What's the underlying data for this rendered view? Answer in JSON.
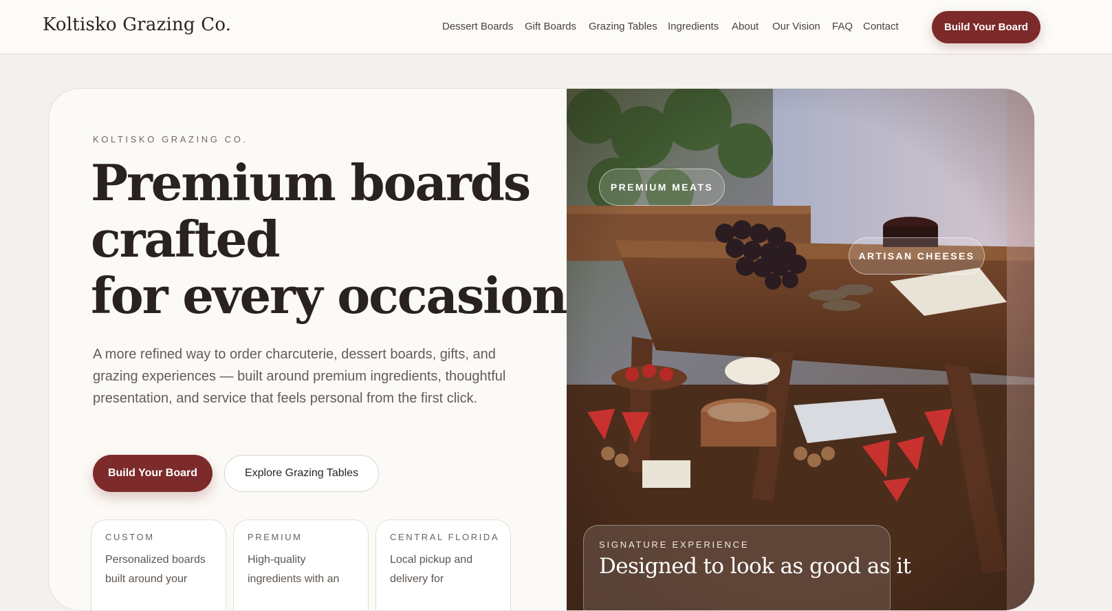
{
  "brand": {
    "name": "Koltisko Grazing Co."
  },
  "nav": {
    "items": [
      {
        "label": "Dessert Boards"
      },
      {
        "label": "Gift Boards"
      },
      {
        "label": "Grazing Tables"
      },
      {
        "label": "Ingredients"
      },
      {
        "label": "About"
      },
      {
        "label": "Our Vision"
      },
      {
        "label": "FAQ"
      },
      {
        "label": "Contact"
      }
    ],
    "cta_label": "Build Your Board"
  },
  "hero": {
    "eyebrow": "KOLTISKO GRAZING CO.",
    "headline": {
      "line1": "Premium boards",
      "line2": "crafted",
      "line3": "for every occasion."
    },
    "lead": "A more refined way to order charcuterie, dessert boards, gifts, and grazing experiences — built around premium ingredients, thoughtful presentation, and service that feels personal from the first click.",
    "primary_button": "Build Your Board",
    "secondary_button": "Explore Grazing Tables",
    "features": [
      {
        "title": "CUSTOM",
        "text": "Personalized boards built around your"
      },
      {
        "title": "PREMIUM",
        "text": "High-quality ingredients with an"
      },
      {
        "title": "CENTRAL FLORIDA",
        "text": "Local pickup and delivery for"
      }
    ]
  },
  "photo": {
    "tags": [
      {
        "label": "PREMIUM MEATS"
      },
      {
        "label": "ARTISAN CHEESES"
      }
    ],
    "signature": {
      "eyebrow": "SIGNATURE EXPERIENCE",
      "title": "Designed to look as good as it"
    }
  },
  "colors": {
    "accent": "#7c2a2a",
    "page_bg": "#f3f1ee",
    "card_bg": "#fcfaf6"
  }
}
